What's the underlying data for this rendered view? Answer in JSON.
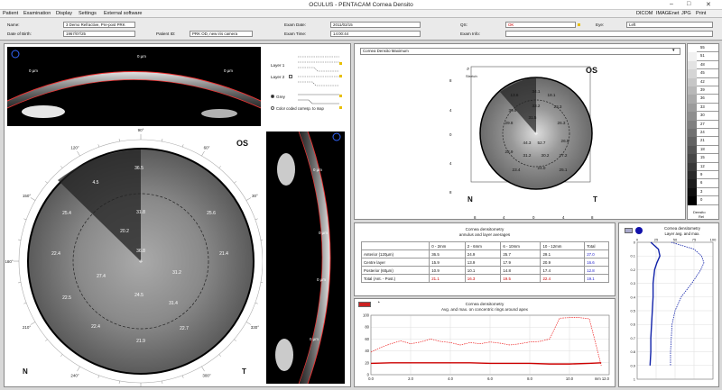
{
  "window": {
    "title": "OCULUS  -  PENTACAM  Cornea Densito",
    "min": "–",
    "max": "□",
    "close": "✕"
  },
  "menu": {
    "left": [
      "Patient",
      "Examination",
      "Display",
      "Settings",
      "External software"
    ],
    "right": [
      "DICOM",
      "IMAGEnet",
      "JPG",
      "Print"
    ]
  },
  "patient": {
    "name_label": "Name:",
    "name": "3 Demo Refractive, Pre-post PRK",
    "dob_label": "Date of Birth:",
    "dob": "1967/07/25",
    "pid_label": "Patient ID:",
    "pid": "PRK OD, new iris camera",
    "exam_date_label": "Exam Date:",
    "exam_date": "2011/02/15",
    "exam_time_label": "Exam Time:",
    "exam_time": "14:00:44",
    "qs_label": "QS:",
    "qs": "OK",
    "eye_label": "Eye:",
    "eye": "Left",
    "exam_info_label": "Exam Info:",
    "exam_info": ""
  },
  "scheimpflug": {
    "micron_labels": [
      "0 µm",
      "0 µm",
      "0 µm"
    ]
  },
  "layers": {
    "layer1": "Layer 1",
    "layer2": "Layer 2",
    "grey": "Grey",
    "color_coded": "Color coded corresp. to map"
  },
  "large_map": {
    "eye": "OS",
    "left": "N",
    "right": "T",
    "angles": [
      "90°",
      "60°",
      "30°",
      "0°",
      "330°",
      "300°",
      "270°",
      "240°",
      "210°",
      "180°",
      "150°",
      "120°"
    ],
    "values": [
      {
        "v": "4.5"
      },
      {
        "v": "36.5"
      },
      {
        "v": "25.4"
      },
      {
        "v": "31.8"
      },
      {
        "v": "25.6"
      },
      {
        "v": "20.2"
      },
      {
        "v": "22.4"
      },
      {
        "v": "21.4"
      },
      {
        "v": "27.4"
      },
      {
        "v": "36.8"
      },
      {
        "v": "31.2"
      },
      {
        "v": "24.5"
      },
      {
        "v": "22.5"
      },
      {
        "v": "31.4"
      },
      {
        "v": "22.4"
      },
      {
        "v": "22.7"
      },
      {
        "v": "21.9"
      }
    ]
  },
  "vertical_scan": {
    "micron_labels": [
      "0 µm",
      "0 µm",
      "0 µm",
      "0 µm"
    ]
  },
  "small_map": {
    "dropdown": "Cornea Densito Maximum",
    "eye": "OS",
    "left": "N",
    "right": "T",
    "stretch": "Stretch",
    "x_ticks": [
      "8",
      "4",
      "0",
      "4",
      "8"
    ],
    "y_ticks": [
      "8",
      "4",
      "0",
      "4",
      "8"
    ],
    "values": [
      "13.6",
      "34.1",
      "18.1",
      "30.9",
      "33.2",
      "23.3",
      "29.8",
      "31.5",
      "26.3",
      "44.3",
      "52.7",
      "26.5",
      "22.9",
      "31.2",
      "30.2",
      "27.2",
      "23.4",
      "24.0",
      "25.1"
    ]
  },
  "scale": {
    "values": [
      "55",
      "51",
      "48",
      "45",
      "42",
      "39",
      "36",
      "33",
      "30",
      "27",
      "24",
      "21",
      "18",
      "15",
      "12",
      "9",
      "6",
      "3",
      "0"
    ],
    "label1": "Densito",
    "label2": "Rel"
  },
  "density_table": {
    "title1": "Cornea densitometry",
    "title2": "annulus and layer averages",
    "headers": [
      "",
      "0 - 2mm",
      "2 - 6mm",
      "6 - 10mm",
      "10 - 12mm",
      "Total"
    ],
    "rows": [
      [
        "Anterior (120µm)",
        "36.5",
        "24.9",
        "25.7",
        "29.1",
        "27.0"
      ],
      [
        "Centre layer",
        "15.9",
        "13.9",
        "17.9",
        "20.9",
        "16.6"
      ],
      [
        "Posterior (60µm)",
        "10.9",
        "10.1",
        "14.8",
        "17.4",
        "12.8"
      ],
      [
        "Total (Ant. - Post.)",
        "21.1",
        "16.3",
        "19.5",
        "22.4",
        "19.1"
      ]
    ]
  },
  "ring_graph": {
    "title1": "Cornea densitometry",
    "title2": "Avg. and max. on concentric rings around apex",
    "x_ticks": [
      "0.0",
      "2.0",
      "4.0",
      "6.0",
      "8.0",
      "10.0"
    ],
    "x_unit": "mm 12.0",
    "y_ticks": [
      "100",
      "80",
      "60",
      "40",
      "20",
      "0"
    ]
  },
  "layer_graph": {
    "title1": "Cornea densitometry",
    "title2": "Layer avg. and max.",
    "x_ticks": [
      "0",
      "25",
      "50",
      "75",
      "100"
    ],
    "y_ticks": [
      "0",
      "0.1",
      "0.2",
      "0.3",
      "0.4",
      "0.5",
      "0.6",
      "0.7",
      "0.8",
      "0.9",
      "1"
    ]
  },
  "chart_data": [
    {
      "type": "line",
      "title": "Cornea densitometry",
      "subtitle": "Avg. and max. on concentric rings around apex",
      "xlabel": "mm",
      "xlim": [
        0,
        12
      ],
      "ylim": [
        0,
        100
      ],
      "series": [
        {
          "name": "max",
          "x": [
            0,
            0.5,
            1,
            1.5,
            2,
            2.5,
            3,
            3.5,
            4,
            4.5,
            5,
            5.5,
            6,
            6.5,
            7,
            7.5,
            8,
            8.5,
            9,
            9.5,
            10,
            10.5,
            11,
            11.3,
            11.6
          ],
          "values": [
            38,
            46,
            52,
            57,
            52,
            55,
            60,
            56,
            54,
            50,
            54,
            52,
            55,
            53,
            50,
            52,
            55,
            56,
            60,
            95,
            96,
            96,
            94,
            55,
            15
          ]
        },
        {
          "name": "avg",
          "x": [
            0,
            1,
            2,
            3,
            4,
            5,
            6,
            7,
            8,
            9,
            10,
            11,
            11.6
          ],
          "values": [
            19,
            20,
            20,
            20,
            20,
            20,
            19,
            19,
            19,
            18,
            18,
            19,
            20
          ]
        }
      ]
    },
    {
      "type": "line",
      "title": "Cornea densitometry",
      "subtitle": "Layer avg. and max.",
      "xlim": [
        0,
        100
      ],
      "ylim": [
        0,
        1
      ],
      "series": [
        {
          "name": "avg",
          "x": [
            18,
            28,
            30,
            26,
            23,
            21,
            21,
            20,
            19,
            18,
            18,
            17
          ],
          "values": [
            0,
            0.05,
            0.1,
            0.15,
            0.2,
            0.3,
            0.4,
            0.5,
            0.6,
            0.7,
            0.8,
            0.9
          ]
        },
        {
          "name": "max",
          "x": [
            45,
            75,
            85,
            88,
            84,
            72,
            58,
            50,
            46,
            45,
            44,
            44
          ],
          "values": [
            0,
            0.05,
            0.1,
            0.15,
            0.2,
            0.3,
            0.4,
            0.5,
            0.6,
            0.7,
            0.8,
            0.9
          ]
        }
      ]
    }
  ]
}
